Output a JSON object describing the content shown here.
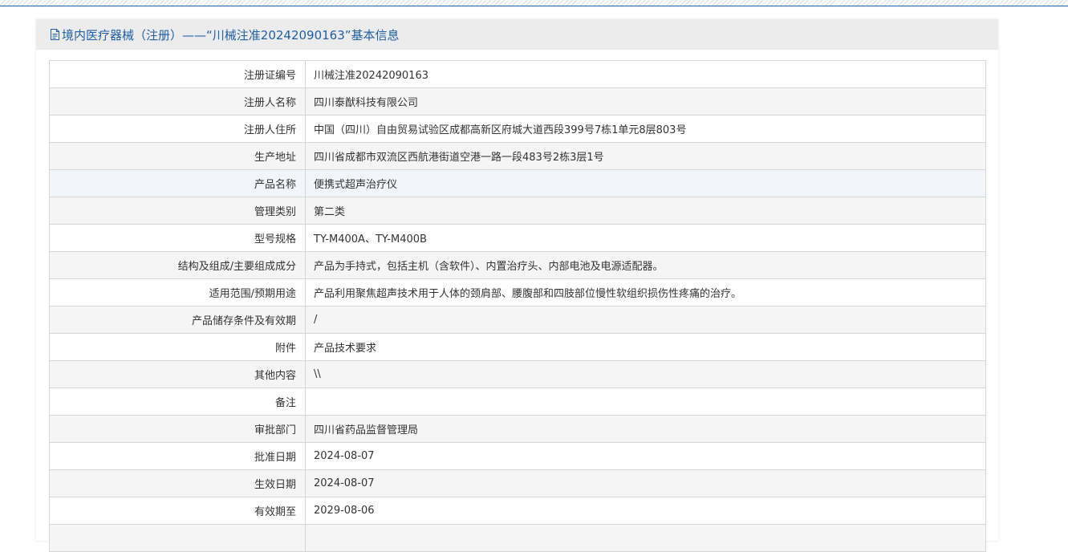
{
  "colors": {
    "accent": "#1f5ea8",
    "header_bg": "#ececec",
    "row_alt_bg": "#f5f5f5",
    "border": "#d6d6d6"
  },
  "panel": {
    "icon": "document-icon",
    "title": "境内医疗器械（注册）——“川械注准20242090163”基本信息"
  },
  "rows": [
    {
      "label": "注册证编号",
      "value": "川械注准20242090163"
    },
    {
      "label": "注册人名称",
      "value": "四川泰猷科技有限公司"
    },
    {
      "label": "注册人住所",
      "value": "中国（四川）自由贸易试验区成都高新区府城大道西段399号7栋1单元8层803号"
    },
    {
      "label": "生产地址",
      "value": "四川省成都市双流区西航港街道空港一路一段483号2栋3层1号"
    },
    {
      "label": "产品名称",
      "value": "便携式超声治疗仪"
    },
    {
      "label": "管理类别",
      "value": "第二类"
    },
    {
      "label": "型号规格",
      "value": "TY-M400A、TY-M400B"
    },
    {
      "label": "结构及组成/主要组成成分",
      "value": "产品为手持式，包括主机（含软件）、内置治疗头、内部电池及电源适配器。"
    },
    {
      "label": "适用范围/预期用途",
      "value": "产品利用聚焦超声技术用于人体的颈肩部、腰腹部和四肢部位慢性软组织损伤性疼痛的治疗。"
    },
    {
      "label": "产品储存条件及有效期",
      "value": "/"
    },
    {
      "label": "附件",
      "value": "产品技术要求"
    },
    {
      "label": "其他内容",
      "value": "\\\\"
    },
    {
      "label": "备注",
      "value": ""
    },
    {
      "label": "审批部门",
      "value": "四川省药品监督管理局"
    },
    {
      "label": "批准日期",
      "value": "2024-08-07"
    },
    {
      "label": "生效日期",
      "value": "2024-08-07"
    },
    {
      "label": "有效期至",
      "value": "2029-08-06"
    },
    {
      "label": "",
      "value": ""
    }
  ]
}
